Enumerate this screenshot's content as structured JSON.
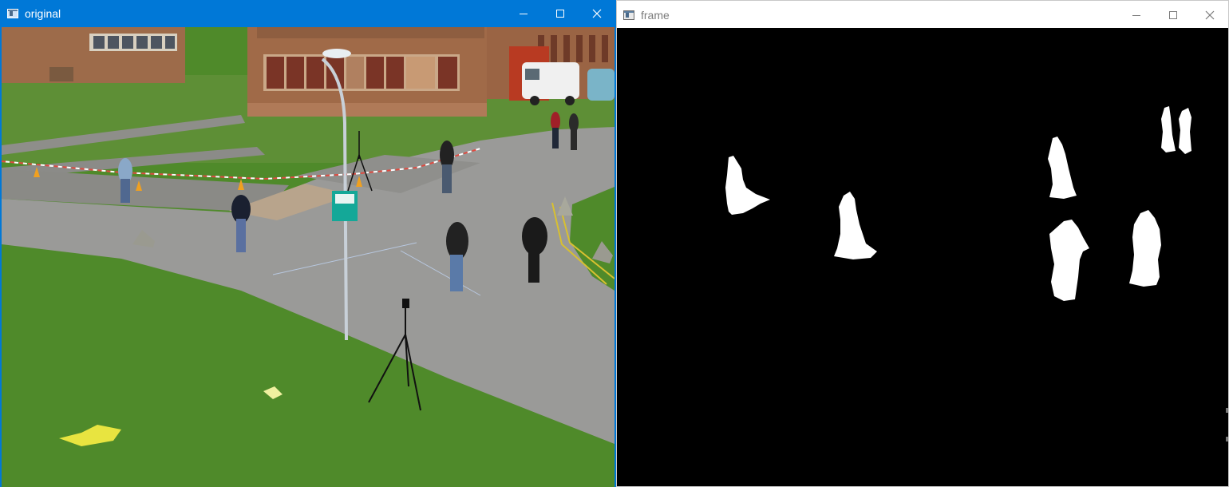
{
  "windows": {
    "original": {
      "title": "original"
    },
    "frame": {
      "title": "frame"
    }
  },
  "controls": {
    "minimize": "minimize-icon",
    "maximize": "maximize-icon",
    "close": "close-icon"
  },
  "colors": {
    "active_titlebar": "#0078d7",
    "inactive_title_text": "#7a7a7a",
    "mask_background": "#000000",
    "mask_foreground": "#ffffff",
    "grass": "#4f8a2a",
    "road": "#9a9a9a",
    "brick": "#a06a48"
  }
}
